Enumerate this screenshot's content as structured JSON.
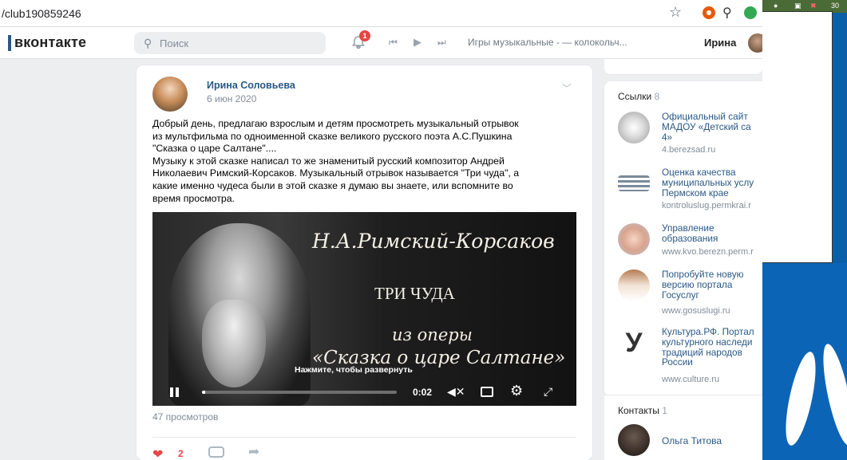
{
  "browser": {
    "url": "/club190859246"
  },
  "vk": {
    "logo": "вконтакте",
    "search_placeholder": "Поиск",
    "notifications_badge": "1",
    "player_track": "Игры музыкальные - — колокольч...",
    "user_name": "Ирина"
  },
  "post": {
    "author": "Ирина Соловьева",
    "date": "6 июн 2020",
    "text_lines": [
      "Добрый день, предлагаю взрослым и детям просмотреть музыкальный отрывок",
      "из мультфильма по одноименной сказке великого русского поэта А.С.Пушкина",
      "\"Сказка о царе Салтане\"....",
      "Музыку к этой сказке написал то же знаменитый русский композитор Андрей",
      "Николаевич Римский-Корсаков. Музыкальный отрывок называется \"Три чуда\", а",
      "какие именно чудеса были в этой сказке я думаю вы знаете, или вспомните во",
      "время просмотра."
    ],
    "video": {
      "title_line1": "Н.А.Римский-Корсаков",
      "title_line2": "ТРИ ЧУДА",
      "title_line3": "из оперы",
      "title_line4": "«Сказка о царе Салтане»",
      "expand_hint": "Нажмите, чтобы развернуть",
      "time": "0:02",
      "progress_fraction": 0.015
    },
    "views": "47 просмотров",
    "likes": "2"
  },
  "sidebar": {
    "links_header": "Ссылки",
    "links_count": "8",
    "links": [
      {
        "title": "Официальный сайт\nМАДОУ «Детский са\n4»",
        "url": "4.berezsad.ru"
      },
      {
        "title": "Оценка качества\nмуниципальных услу\nПермском крае",
        "url": "kontroluslug.permkrai.r"
      },
      {
        "title": "Управление\nобразования",
        "url": "www.kvo.berezn.perm.r"
      },
      {
        "title": "Попробуйте новую\nверсию портала\nГосуслуг",
        "url": "www.gosuslugi.ru"
      },
      {
        "title": "Культура.РФ. Портал\nкультурного наследи\nтрадиций народов\nРоссии",
        "url": "www.culture.ru"
      }
    ],
    "contacts_header": "Контакты",
    "contacts_count": "1",
    "contact_name": "Ольга Титова"
  },
  "desktop": {
    "tray_text": "30"
  },
  "colors": {
    "vk_link": "#2a5885",
    "like_red": "#e64646",
    "page_bg": "#edeef0"
  }
}
